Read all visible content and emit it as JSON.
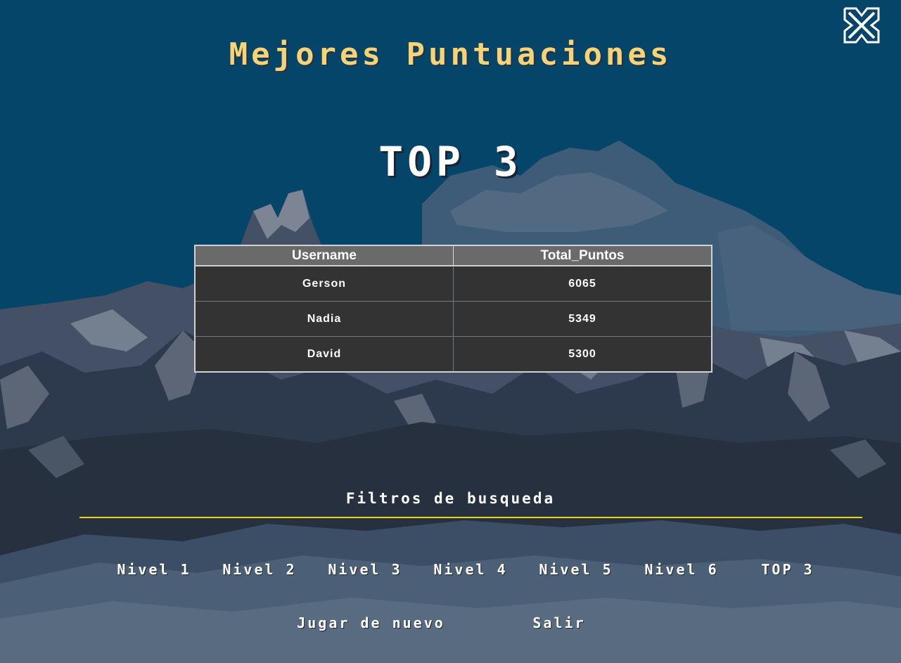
{
  "title": "Mejores Puntuaciones",
  "heading": "TOP 3",
  "table": {
    "headers": [
      "Username",
      "Total_Puntos"
    ],
    "rows": [
      [
        "Gerson",
        "6065"
      ],
      [
        "Nadia",
        "5349"
      ],
      [
        "David",
        "5300"
      ]
    ]
  },
  "filters": {
    "label": "Filtros de busqueda",
    "buttons": [
      "Nivel 1",
      "Nivel 2",
      "Nivel 3",
      "Nivel 4",
      "Nivel 5",
      "Nivel 6",
      "TOP 3"
    ]
  },
  "actions": {
    "play_again": "Jugar de nuevo",
    "exit": "Salir"
  },
  "colors": {
    "sky": "#06456a",
    "title": "#f3d47a",
    "divider": "#e8d800",
    "table_header": "#6a6a6a",
    "table_cell": "#333333"
  },
  "icons": {
    "close": "close-x-icon"
  }
}
